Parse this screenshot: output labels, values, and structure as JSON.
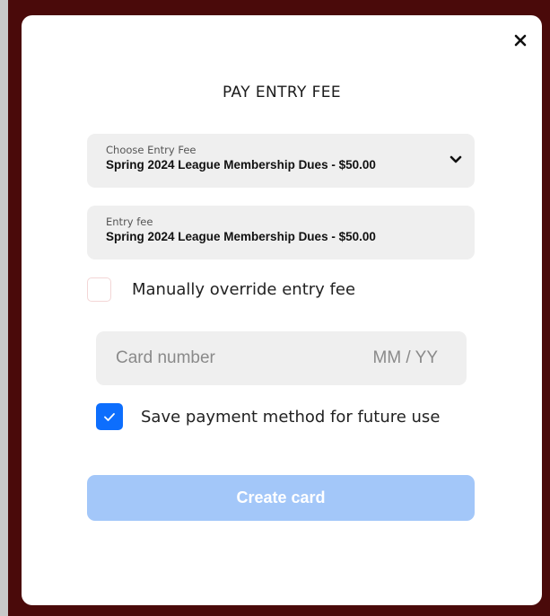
{
  "modal": {
    "title": "PAY ENTRY FEE",
    "close_icon": "close-icon"
  },
  "choose_fee": {
    "label": "Choose Entry Fee",
    "selected": "Spring 2024 League Membership Dues - $50.00",
    "icon": "chevron-down-icon"
  },
  "entry_fee": {
    "label": "Entry fee",
    "value": "Spring 2024 League Membership Dues - $50.00"
  },
  "override": {
    "label": "Manually override entry fee",
    "checked": false
  },
  "card": {
    "number_placeholder": "Card number",
    "expiry_placeholder": "MM / YY"
  },
  "save_method": {
    "label": "Save payment method for future use",
    "checked": true
  },
  "submit": {
    "label": "Create card"
  },
  "colors": {
    "accent": "#0d6efd",
    "button_disabled": "#a3c7f9",
    "backdrop": "#4a0a0a",
    "field_bg": "#efefef"
  }
}
